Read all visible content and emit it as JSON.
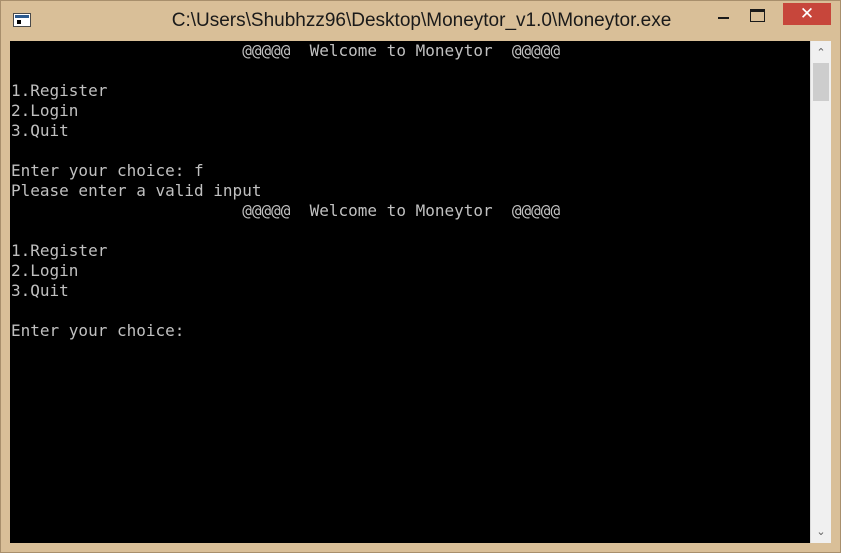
{
  "window": {
    "title": "C:\\Users\\Shubhzz96\\Desktop\\Moneytor_v1.0\\Moneytor.exe",
    "controls": {
      "minimize_icon": "minimize-icon",
      "maximize_icon": "maximize-icon",
      "close_glyph": "✕"
    }
  },
  "console": {
    "background": "#000000",
    "foreground": "#c0c0c0",
    "lines": [
      "                        @@@@@  Welcome to Moneytor  @@@@@",
      "",
      "1.Register",
      "2.Login",
      "3.Quit",
      "",
      "Enter your choice: f",
      "Please enter a valid input",
      "                        @@@@@  Welcome to Moneytor  @@@@@",
      "",
      "1.Register",
      "2.Login",
      "3.Quit",
      "",
      "Enter your choice: "
    ]
  },
  "scrollbar": {
    "up_glyph": "⌃",
    "down_glyph": "⌄"
  }
}
